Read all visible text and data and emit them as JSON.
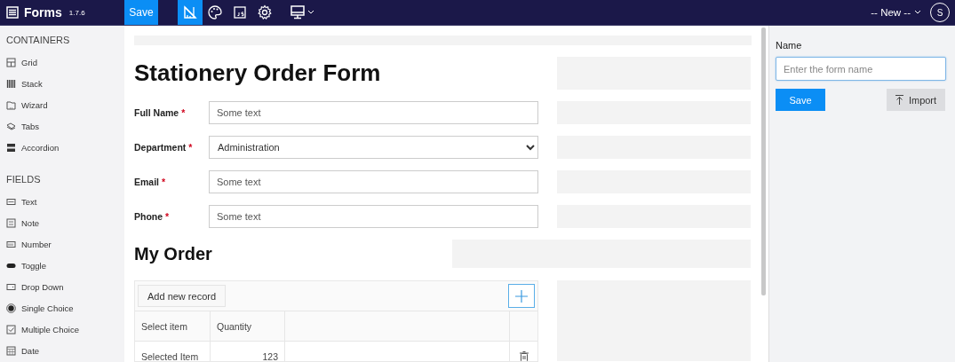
{
  "app": {
    "title": "Forms",
    "version": "1.7.6"
  },
  "toolbar": {
    "save": "Save",
    "tools": [
      {
        "kind": "designer",
        "selected": true
      },
      {
        "kind": "theme",
        "selected": false
      },
      {
        "kind": "script",
        "selected": false
      },
      {
        "kind": "settings",
        "selected": false
      },
      {
        "kind": "device",
        "selected": false
      }
    ],
    "form_select": "-- New --",
    "avatar": "S"
  },
  "sidebar": {
    "sections": [
      {
        "title": "CONTAINERS",
        "items": [
          {
            "label": "Grid",
            "kind": "grid"
          },
          {
            "label": "Stack",
            "kind": "stack"
          },
          {
            "label": "Wizard",
            "kind": "wizard"
          },
          {
            "label": "Tabs",
            "kind": "tabs"
          },
          {
            "label": "Accordion",
            "kind": "accordion"
          }
        ]
      },
      {
        "title": "FIELDS",
        "items": [
          {
            "label": "Text",
            "kind": "text"
          },
          {
            "label": "Note",
            "kind": "note"
          },
          {
            "label": "Number",
            "kind": "number"
          },
          {
            "label": "Toggle",
            "kind": "toggle"
          },
          {
            "label": "Drop Down",
            "kind": "dropdown"
          },
          {
            "label": "Single Choice",
            "kind": "radio"
          },
          {
            "label": "Multiple Choice",
            "kind": "checkbox"
          },
          {
            "label": "Date",
            "kind": "date"
          }
        ]
      }
    ]
  },
  "form": {
    "title": "Stationery Order Form",
    "fields": [
      {
        "label": "Full Name",
        "required_mark": "*",
        "kind": "text",
        "placeholder": "Some text"
      },
      {
        "label": "Department",
        "required_mark": "*",
        "kind": "select",
        "value": "Administration"
      },
      {
        "label": "Email",
        "required_mark": "*",
        "kind": "text",
        "placeholder": "Some text"
      },
      {
        "label": "Phone",
        "required_mark": "*",
        "kind": "text",
        "placeholder": "Some text"
      }
    ],
    "section_title": "My Order",
    "table": {
      "add_button": "Add new record",
      "columns": [
        "Select item",
        "Quantity"
      ],
      "rows": [
        {
          "cells": [
            "Selected Item",
            "123"
          ]
        }
      ]
    }
  },
  "properties": {
    "name_label": "Name",
    "name_placeholder": "Enter the form name",
    "save": "Save",
    "import": "Import"
  }
}
